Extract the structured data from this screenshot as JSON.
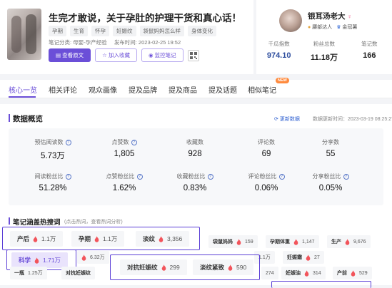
{
  "note": {
    "title": "生完才敢说，关于孕肚的护理干货和真心话！",
    "tags": [
      "孕期",
      "生育",
      "怀孕",
      "妊娠纹",
      "袋鼠妈妈怎么样",
      "身体变化"
    ],
    "category_label": "笔记分类: 母婴-孕产经验",
    "publish_label": "发布时间: 2023-02-25 19:52",
    "buttons": {
      "view_original": "查看原文",
      "add_favorite": "加入收藏",
      "monitor": "监控笔记"
    }
  },
  "user": {
    "name": "银耳汤老大",
    "badge1": "腰部达人",
    "badge2": "金冠薯",
    "stats": [
      {
        "label": "千瓜指数",
        "value": "974.10"
      },
      {
        "label": "粉丝总数",
        "value": "11.18万"
      },
      {
        "label": "笔记数",
        "value": "166"
      }
    ]
  },
  "tabs": [
    "核心一览",
    "相关评论",
    "观众画像",
    "提及品牌",
    "提及商品",
    "提及话题",
    "相似笔记"
  ],
  "new_badge": "NEW",
  "overview": {
    "title": "数据概览",
    "update_label": "更新数据",
    "update_time": "数据更新时间：2023-03-19 08:25:27",
    "metrics_row1": [
      {
        "label": "预估阅读数",
        "value": "5.73万"
      },
      {
        "label": "点赞数",
        "value": "1,805"
      },
      {
        "label": "收藏数",
        "value": "928"
      },
      {
        "label": "评论数",
        "value": "69"
      },
      {
        "label": "分享数",
        "value": "55"
      }
    ],
    "metrics_row2": [
      {
        "label": "阅读粉丝比",
        "value": "51.28%"
      },
      {
        "label": "点赞粉丝比",
        "value": "1.62%"
      },
      {
        "label": "收藏粉丝比",
        "value": "0.83%"
      },
      {
        "label": "评论粉丝比",
        "value": "0.06%"
      },
      {
        "label": "分享粉丝比",
        "value": "0.05%"
      }
    ]
  },
  "hotwords": {
    "title": "笔记涵盖热搜词",
    "subtitle": "(点击热词，查看热词分析)",
    "row1_big": [
      {
        "k": "产后",
        "n": "1.1万"
      },
      {
        "k": "孕期",
        "n": "1.1万"
      },
      {
        "k": "淡纹",
        "n": "3,356"
      }
    ],
    "row1_small": [
      {
        "k": "袋鼠妈妈",
        "n": "159"
      },
      {
        "k": "孕期体重",
        "n": "1,147"
      },
      {
        "k": "生产",
        "n": "9,676"
      }
    ],
    "row2": [
      {
        "k": "科学",
        "n": "1.71万"
      },
      {
        "k": "",
        "n": "6.32万"
      },
      {
        "k": "",
        "n": "1.1万"
      },
      {
        "k": "妊娠霜",
        "n": "27"
      }
    ],
    "row3_big": [
      {
        "k": "对抗妊娠纹",
        "n": "299"
      },
      {
        "k": "淡纹紧致",
        "n": "590"
      }
    ],
    "row3_small": [
      {
        "k": "一瓶",
        "n": "1.25万"
      },
      {
        "k": "对抗妊娠纹",
        "n": ""
      },
      {
        "k": "",
        "n": "274"
      },
      {
        "k": "妊娠油",
        "n": "314"
      },
      {
        "k": "产前",
        "n": "529"
      }
    ]
  }
}
